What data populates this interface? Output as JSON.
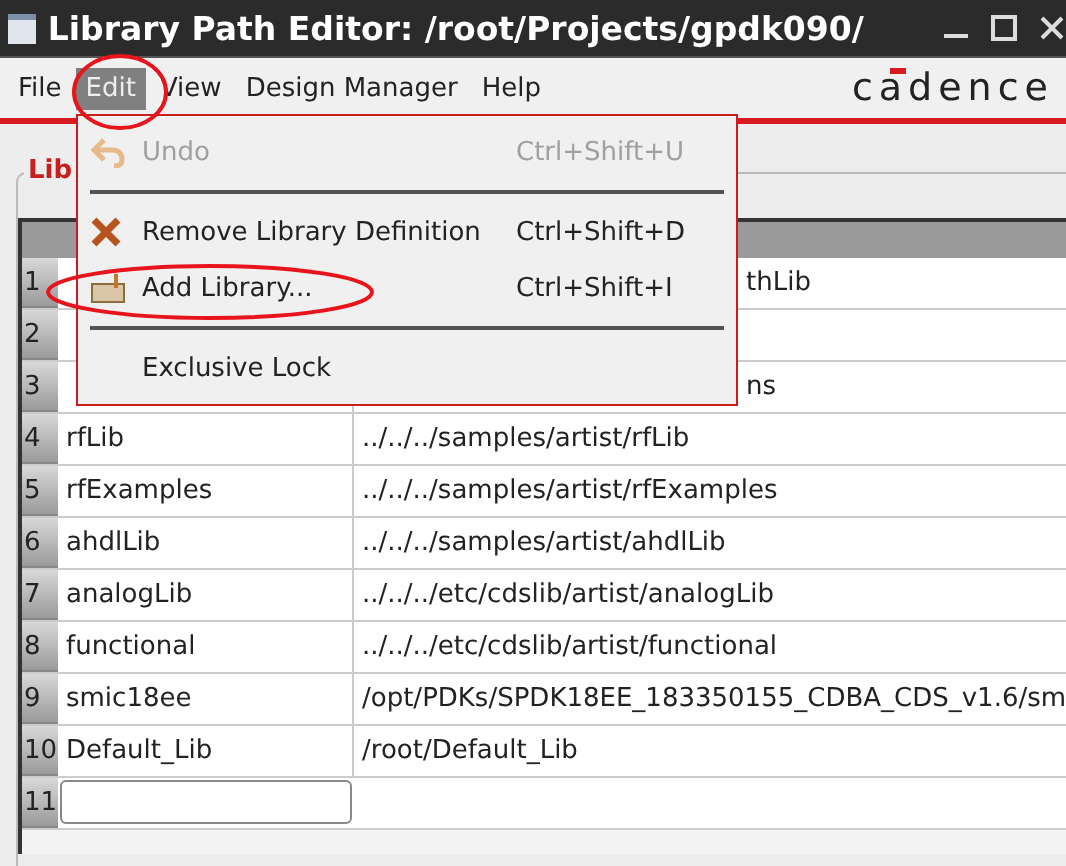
{
  "window": {
    "title": "Library Path Editor: /root/Projects/gpdk090/"
  },
  "menu_bar": [
    {
      "label": "File",
      "selected": false
    },
    {
      "label": "Edit",
      "selected": true
    },
    {
      "label": "View",
      "selected": false
    },
    {
      "label": "Design Manager",
      "selected": false
    },
    {
      "label": "Help",
      "selected": false
    }
  ],
  "logo": "cadence",
  "group_label": "Lib",
  "edit_menu": [
    {
      "kind": "undo",
      "label": "Undo",
      "shortcut": "Ctrl+Shift+U",
      "disabled": true
    },
    {
      "kind": "separator"
    },
    {
      "kind": "remove",
      "label": "Remove Library Definition",
      "shortcut": "Ctrl+Shift+D",
      "disabled": false
    },
    {
      "kind": "add",
      "label": "Add Library...",
      "shortcut": "Ctrl+Shift+I",
      "disabled": false
    },
    {
      "kind": "separator"
    },
    {
      "kind": "plain",
      "label": "Exclusive Lock",
      "disabled": false
    }
  ],
  "table": {
    "rows": [
      {
        "number": "1",
        "cells": [
          "",
          "thLib"
        ],
        "covered": true
      },
      {
        "number": "2",
        "cells": [
          "",
          ""
        ]
      },
      {
        "number": "3",
        "cells": [
          "",
          "ns"
        ],
        "covered": true
      },
      {
        "number": "4",
        "cells": [
          "rfLib",
          "../../../samples/artist/rfLib"
        ],
        "covered": false
      },
      {
        "number": "5",
        "cells": [
          "rfExamples",
          "../../../samples/artist/rfExamples"
        ],
        "covered": false
      },
      {
        "number": "6",
        "cells": [
          "ahdlLib",
          "../../../samples/artist/ahdlLib"
        ],
        "covered": false
      },
      {
        "number": "7",
        "cells": [
          "analogLib",
          "../../../etc/cdslib/artist/analogLib"
        ],
        "covered": false
      },
      {
        "number": "8",
        "cells": [
          "functional",
          "../../../etc/cdslib/artist/functional"
        ],
        "covered": false
      },
      {
        "number": "9",
        "cells": [
          "smic18ee",
          "/opt/PDKs/SPDK18EE_183350155_CDBA_CDS_v1.6/sm"
        ],
        "covered": false
      },
      {
        "number": "10",
        "cells": [
          "Default_Lib",
          "/root/Default_Lib"
        ],
        "covered": false
      },
      {
        "number": "11",
        "cells": [
          "",
          ""
        ],
        "covered": false,
        "editing": true
      }
    ]
  }
}
